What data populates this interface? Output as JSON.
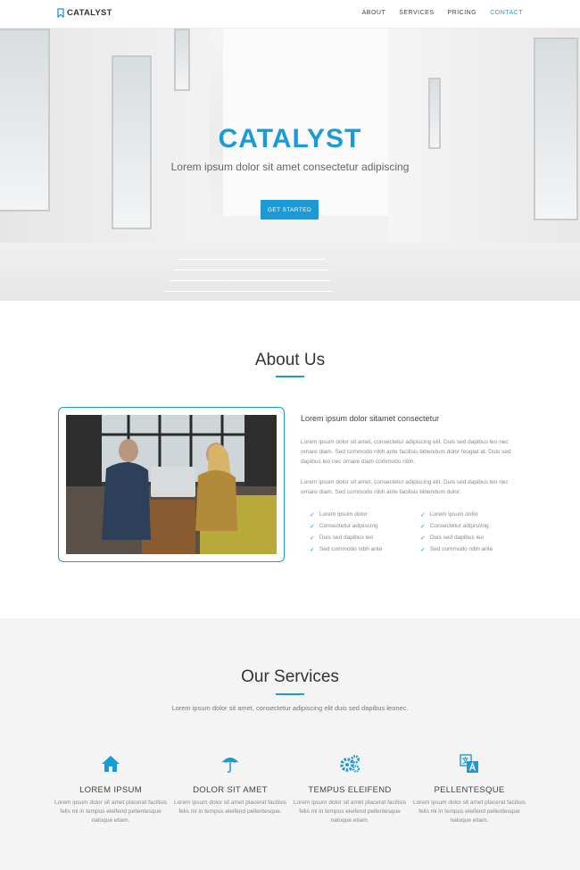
{
  "nav": {
    "brand": "CATALYST",
    "items": [
      {
        "label": "ABOUT",
        "active": false
      },
      {
        "label": "SERVICES",
        "active": false
      },
      {
        "label": "PRICING",
        "active": false
      },
      {
        "label": "CONTACT",
        "active": true
      }
    ]
  },
  "hero": {
    "title": "CATALYST",
    "subtitle": "Lorem ipsum dolor sit amet consectetur adipiscing",
    "button": "GET STARTED"
  },
  "about": {
    "title": "About Us",
    "heading": "Lorem ipsum dolor sitamet consectetur",
    "p1": "Lorem ipsum dolor sit amet, consectetur adipiscing elit. Duis sed dapibus leo nec ornare diam. Sed commodo nibh ante facilisis bibendum dolor feugiat at. Duis sed dapibus leo nec ornare diam commodo nibh.",
    "p2": "Lorem ipsum dolor sit amet, consectetur adipiscing elit. Duis sed dapibus leo nec ornare diam. Sed commodo nibh ante facilisis bibendum dolor.",
    "list_left": [
      "Lorem ipsum dolor",
      "Consectetur adipiscing",
      "Duis sed dapibus leo",
      "Sed commodo nibh ante"
    ],
    "list_right": [
      "Lorem ipsum dolor",
      "Consectetur adipiscing",
      "Duis sed dapibus leo",
      "Sed commodo nibh ante"
    ]
  },
  "services": {
    "title": "Our Services",
    "description": "Lorem ipsum dolor sit amet, consectetur adipiscing elit duis sed dapibus leonec.",
    "cards": [
      {
        "icon": "home-icon",
        "title": "LOREM IPSUM",
        "text": "Lorem ipsum dolor sit amet placerat facilisis felis mi in tempus eleifend pellentesque natoque etiam."
      },
      {
        "icon": "umbrella-icon",
        "title": "DOLOR SIT AMET",
        "text": "Lorem ipsum dolor sit amet placerat facilisis felis mi in tempus eleifend pellentesque."
      },
      {
        "icon": "gears-icon",
        "title": "TEMPUS ELEIFEND",
        "text": "Lorem ipsum dolor sit amet placerat facilisis felis mi in tempus eleifend pellentesque natoque etiam."
      },
      {
        "icon": "translate-icon",
        "title": "PELLENTESQUE",
        "text": "Lorem ipsum dolor sit amet placerat facilisis felis mi in tempus eleifend pellentesque natoque etiam."
      }
    ]
  },
  "colors": {
    "accent": "#1a9bd7",
    "text": "#333333",
    "muted": "#888888",
    "band": "#f4f4f4"
  }
}
